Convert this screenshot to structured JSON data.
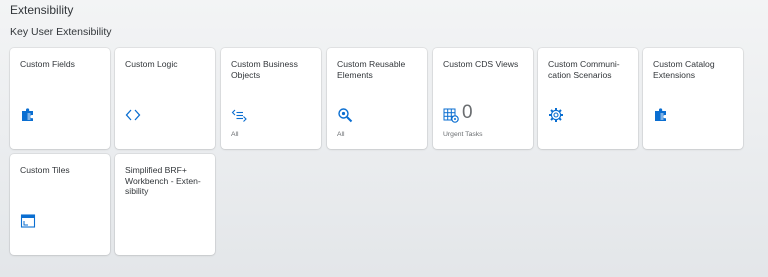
{
  "page": {
    "group_title": "Extensibility",
    "section_title": "Key User Extensibility"
  },
  "colors": {
    "icon_blue": "#0a6ed1",
    "text": "#32363a",
    "subtext": "#6a6d70",
    "tile_bg": "#ffffff"
  },
  "tiles": [
    {
      "title": "Custom Fields",
      "icon": "puzzle-icon"
    },
    {
      "title": "Custom Logic",
      "icon": "code-brackets-icon"
    },
    {
      "title": "Custom Business Objects",
      "icon": "list-arrow-icon",
      "footer": "All"
    },
    {
      "title": "Custom Reusable Elements",
      "icon": "search-gear-icon",
      "footer": "All"
    },
    {
      "title": "Custom CDS Views",
      "icon": "table-gear-icon",
      "kpi": "0",
      "footer": "Urgent Tasks"
    },
    {
      "title": "Custom Communi-cation Scenarios",
      "icon": "gear-icon"
    },
    {
      "title": "Custom Catalog Extensions",
      "icon": "puzzle-icon"
    },
    {
      "title": "Custom Tiles",
      "icon": "tile-window-icon"
    },
    {
      "title": "Simplified BRF+ Workbench - Exten-sibility",
      "icon": ""
    }
  ]
}
